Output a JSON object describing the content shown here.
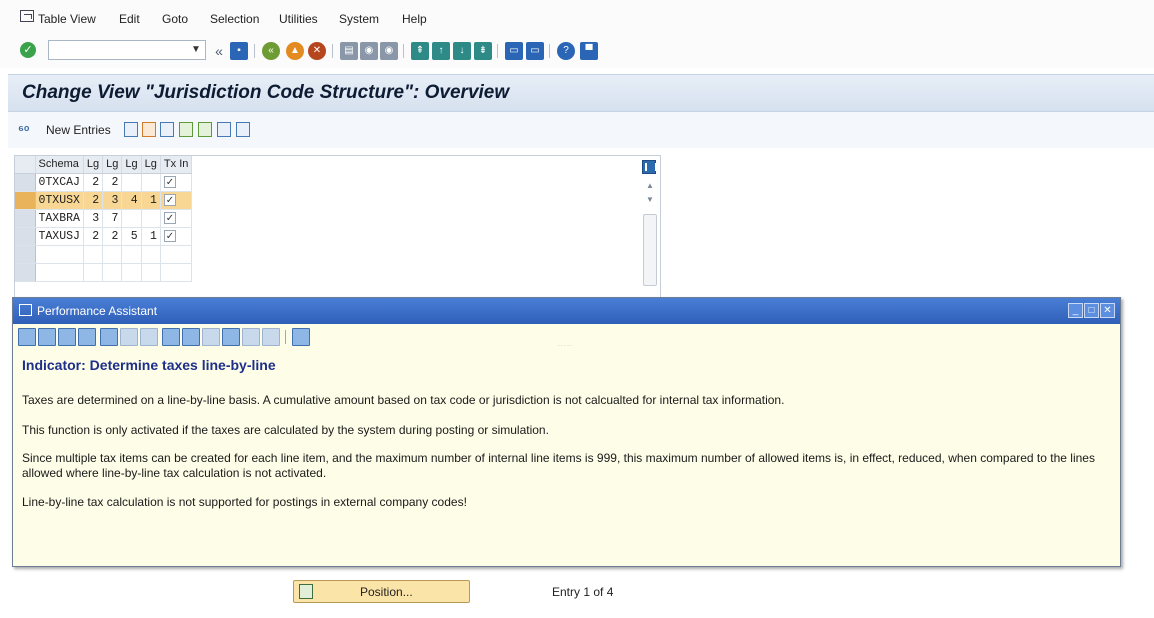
{
  "menu": {
    "items": [
      "Table View",
      "Edit",
      "Goto",
      "Selection",
      "Utilities",
      "System",
      "Help"
    ]
  },
  "toolbar": {
    "command_value": "",
    "icons": [
      "enter-icon",
      "back-arrows-icon",
      "save-icon",
      "back-icon",
      "exit-icon",
      "cancel-icon",
      "print-icon",
      "find-icon",
      "find-next-icon",
      "first-page-icon",
      "prev-page-icon",
      "next-page-icon",
      "last-page-icon",
      "new-session-icon",
      "shortcut-icon",
      "help-icon",
      "customize-icon"
    ]
  },
  "page": {
    "title": "Change View \"Jurisdiction Code Structure\": Overview"
  },
  "app_toolbar": {
    "new_entries_label": "New Entries"
  },
  "table": {
    "headers": [
      "Schema",
      "Lg",
      "Lg",
      "Lg",
      "Lg",
      "Tx In"
    ],
    "rows": [
      {
        "schema": "0TXCAJ",
        "lg1": "2",
        "lg2": "2",
        "lg3": "",
        "lg4": "",
        "checked": "✓",
        "highlight": false
      },
      {
        "schema": "0TXUSX",
        "lg1": "2",
        "lg2": "3",
        "lg3": "4",
        "lg4": "1",
        "checked": "✓",
        "highlight": true
      },
      {
        "schema": "TAXBRA",
        "lg1": "3",
        "lg2": "7",
        "lg3": "",
        "lg4": "",
        "checked": "✓",
        "highlight": false
      },
      {
        "schema": "TAXUSJ",
        "lg1": "2",
        "lg2": "2",
        "lg3": "5",
        "lg4": "1",
        "checked": "✓",
        "highlight": false
      }
    ]
  },
  "assistant": {
    "window_title": "Performance Assistant",
    "heading": "Indicator: Determine taxes line-by-line",
    "paragraphs": [
      "Taxes are determined on a line-by-line basis.  A cumulative amount based on tax code or jurisdiction is not calcualted for internal tax information.",
      "This function is only activated if the taxes are calculated by the system during posting or simulation.",
      "Since multiple tax items can be created for each line item, and the maximum number of internal line items is 999, this maximum number of allowed items is, in effect, reduced, when compared to the lines allowed where line-by-line tax calculation is not activated.",
      "Line-by-line tax calculation is not supported for postings in external company codes!"
    ]
  },
  "footer": {
    "position_label": "Position...",
    "entry_info": "Entry 1 of 4"
  }
}
